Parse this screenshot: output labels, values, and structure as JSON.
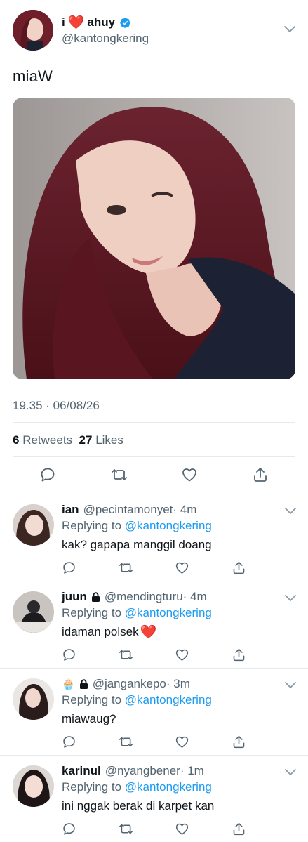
{
  "main_tweet": {
    "name_prefix": "i",
    "name_emoji": "❤️",
    "name_suffix": "ahuy",
    "verified_icon": "verified-badge-icon",
    "handle": "@kantongkering",
    "text": "miaW",
    "timestamp": "19.35 · 06/08/26",
    "retweets_count": "6",
    "retweets_label": "Retweets",
    "likes_count": "27",
    "likes_label": "Likes",
    "actions": [
      "reply-icon",
      "retweet-icon",
      "like-icon",
      "share-icon"
    ]
  },
  "replies": [
    {
      "name": "ian",
      "handle": "@pecintamonyet",
      "time": "· 4m",
      "replying_prefix": "Replying to",
      "replying_to": "@kantongkering",
      "text": "kak? gapapa manggil doang"
    },
    {
      "name": "juun",
      "handle": "@mendingturu",
      "time": "· 4m",
      "replying_prefix": "Replying to",
      "replying_to": "@kantongkering",
      "text": "idaman polsek",
      "text_emoji": "❤️"
    },
    {
      "name_emoji": "🧁",
      "handle": "@jangankepo",
      "time": "· 3m",
      "replying_prefix": "Replying to",
      "replying_to": "@kantongkering",
      "text": "miawaug?"
    },
    {
      "name": "karinul",
      "handle": "@nyangbener",
      "time": "· 1m",
      "replying_prefix": "Replying to",
      "replying_to": "@kantongkering",
      "text": "ini nggak berak di karpet kan"
    }
  ],
  "colors": {
    "accent": "#1d9bf0",
    "secondary_text": "#536471",
    "divider": "#e7e9ea",
    "heart": "#e0245e"
  }
}
